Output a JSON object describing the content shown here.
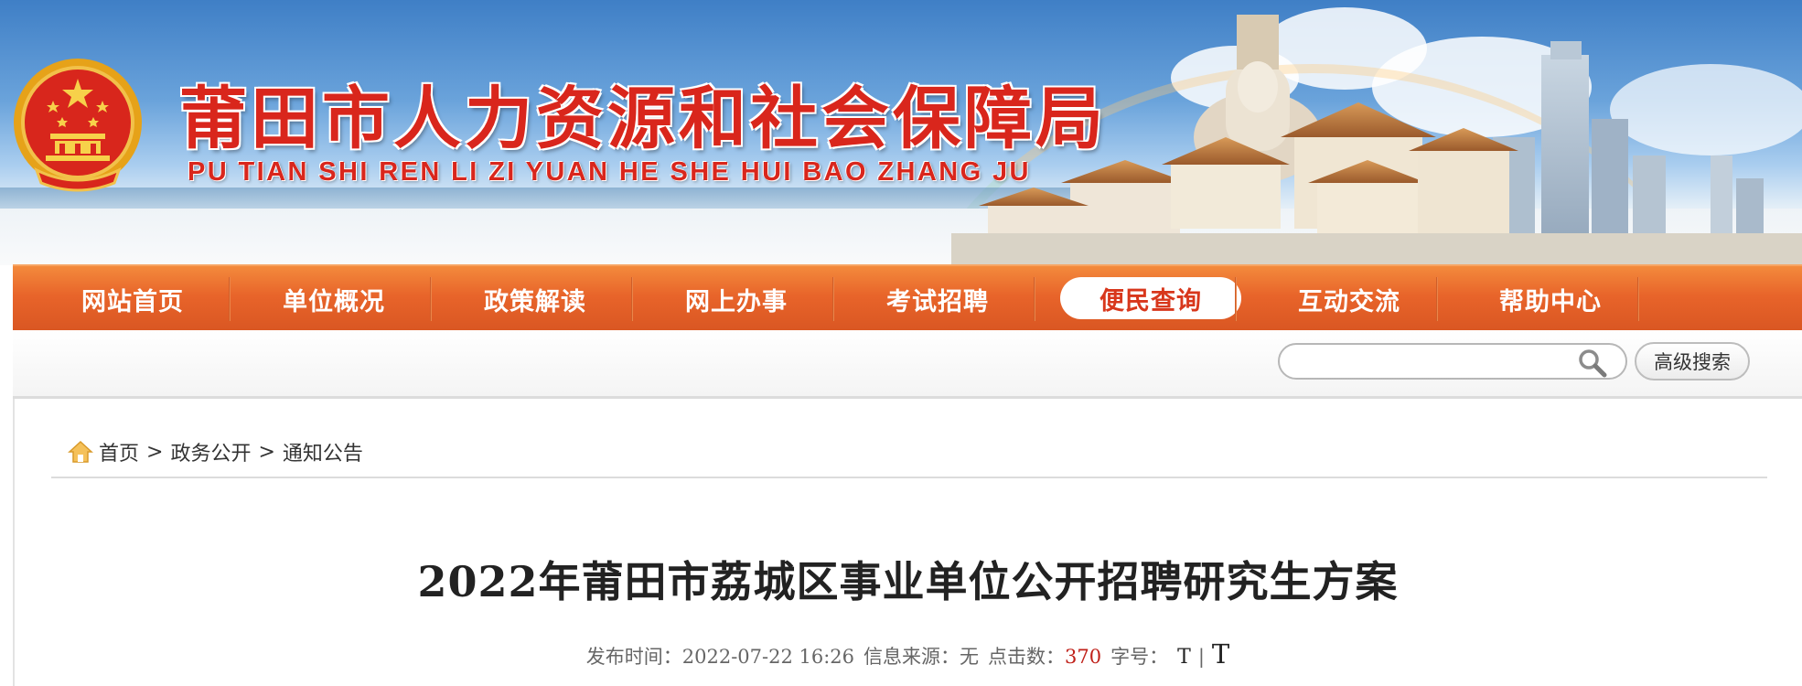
{
  "header": {
    "site_title": "莆田市人力资源和社会保障局",
    "site_subtitle": "PU TIAN SHI REN LI ZI YUAN HE SHE HUI BAO ZHANG JU"
  },
  "nav": {
    "items": [
      {
        "label": "网站首页"
      },
      {
        "label": "单位概况"
      },
      {
        "label": "政策解读"
      },
      {
        "label": "网上办事"
      },
      {
        "label": "考试招聘"
      },
      {
        "label": "便民查询",
        "active": true
      },
      {
        "label": "互动交流"
      },
      {
        "label": "帮助中心"
      }
    ]
  },
  "search": {
    "placeholder": "",
    "advanced_label": "高级搜索"
  },
  "breadcrumb": {
    "home": "首页",
    "separator": ">",
    "level1": "政务公开",
    "level2": "通知公告"
  },
  "article": {
    "title": "2022年莆田市荔城区事业单位公开招聘研究生方案",
    "publish_label": "发布时间：",
    "publish_time": "2022-07-22 16:26",
    "source_label": "信息来源：",
    "source": "无",
    "clicks_label": "点击数：",
    "clicks": "370",
    "font_label": "字号：",
    "font_small": "T",
    "font_separator": "|",
    "font_large": "T"
  },
  "colors": {
    "brand_red": "#d9261c",
    "nav_orange": "#e8642a",
    "clicks_red": "#c0211a"
  }
}
